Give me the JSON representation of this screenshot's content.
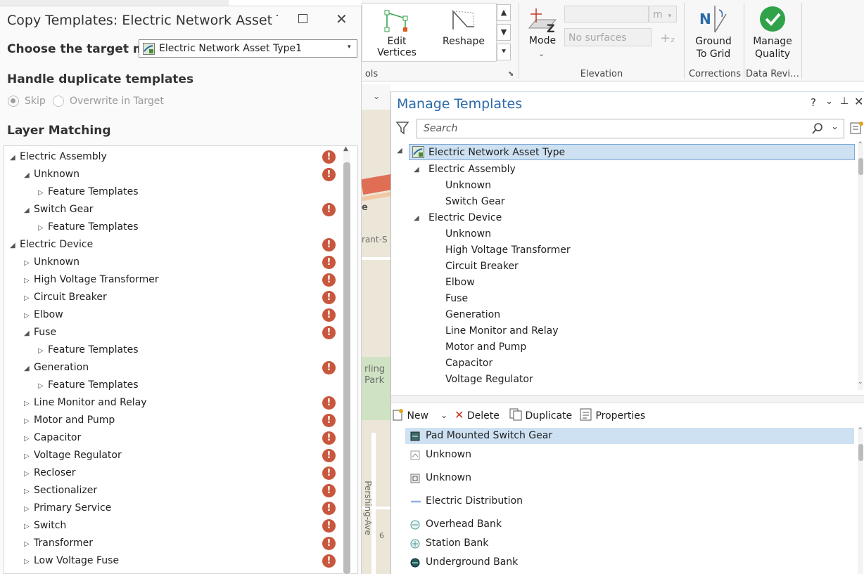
{
  "ribbon": {
    "edit_vertices_label": "Edit\nVertices",
    "reshape_label": "Reshape",
    "tools_group_label": "ols",
    "mode_label": "Mode",
    "unit_value": "m",
    "surface_placeholder": "No surfaces",
    "elevation_group_label": "Elevation",
    "ground_to_grid_label": "Ground\nTo Grid",
    "corrections_group_label": "Corrections",
    "manage_quality_label": "Manage\nQuality",
    "data_reviewer_group_label": "Data Revi…",
    "colors": {
      "green": "#2fa24a",
      "accent_blue": "#2b6aa8"
    }
  },
  "map": {
    "labels": [
      "e",
      "rant-S",
      "rling",
      "Park",
      "Pershing-Ave",
      "6"
    ]
  },
  "copy_dialog": {
    "title": "Copy Templates: Electric Network Asset Typ",
    "target_label": "Choose the target map",
    "target_value": "Electric Network Asset Type1",
    "duplicates_title": "Handle duplicate templates",
    "skip_label": "Skip",
    "overwrite_label": "Overwrite in Target",
    "layer_matching_title": "Layer Matching",
    "tree": [
      {
        "label": "Electric Assembly",
        "level": 0,
        "expanded": true,
        "warn": true
      },
      {
        "label": "Unknown",
        "level": 1,
        "expanded": true,
        "warn": true
      },
      {
        "label": "Feature Templates",
        "level": 2,
        "expanded": false,
        "warn": false
      },
      {
        "label": "Switch Gear",
        "level": 1,
        "expanded": true,
        "warn": true
      },
      {
        "label": "Feature Templates",
        "level": 2,
        "expanded": false,
        "warn": false
      },
      {
        "label": "Electric Device",
        "level": 0,
        "expanded": true,
        "warn": true
      },
      {
        "label": "Unknown",
        "level": 1,
        "expanded": false,
        "warn": true
      },
      {
        "label": "High Voltage Transformer",
        "level": 1,
        "expanded": false,
        "warn": true
      },
      {
        "label": "Circuit Breaker",
        "level": 1,
        "expanded": false,
        "warn": true
      },
      {
        "label": "Elbow",
        "level": 1,
        "expanded": false,
        "warn": true
      },
      {
        "label": "Fuse",
        "level": 1,
        "expanded": true,
        "warn": true
      },
      {
        "label": "Feature Templates",
        "level": 2,
        "expanded": false,
        "warn": false
      },
      {
        "label": "Generation",
        "level": 1,
        "expanded": true,
        "warn": true
      },
      {
        "label": "Feature Templates",
        "level": 2,
        "expanded": false,
        "warn": false
      },
      {
        "label": "Line Monitor and Relay",
        "level": 1,
        "expanded": false,
        "warn": true
      },
      {
        "label": "Motor and Pump",
        "level": 1,
        "expanded": false,
        "warn": true
      },
      {
        "label": "Capacitor",
        "level": 1,
        "expanded": false,
        "warn": true
      },
      {
        "label": "Voltage Regulator",
        "level": 1,
        "expanded": false,
        "warn": true
      },
      {
        "label": "Recloser",
        "level": 1,
        "expanded": false,
        "warn": true
      },
      {
        "label": "Sectionalizer",
        "level": 1,
        "expanded": false,
        "warn": true
      },
      {
        "label": "Primary Service",
        "level": 1,
        "expanded": false,
        "warn": true
      },
      {
        "label": "Switch",
        "level": 1,
        "expanded": false,
        "warn": true
      },
      {
        "label": "Transformer",
        "level": 1,
        "expanded": false,
        "warn": true
      },
      {
        "label": "Low Voltage Fuse",
        "level": 1,
        "expanded": false,
        "warn": true
      }
    ],
    "warn_glyph": "!",
    "colors": {
      "warning": "#c8573d"
    }
  },
  "manage_templates": {
    "title": "Manage Templates",
    "help_glyph": "?",
    "search_placeholder": "Search",
    "map_node": "Electric Network Asset Type",
    "layers": [
      {
        "label": "Electric Assembly",
        "kind": "group"
      },
      {
        "label": "Unknown",
        "kind": "item"
      },
      {
        "label": "Switch Gear",
        "kind": "item"
      },
      {
        "label": "Electric Device",
        "kind": "group"
      },
      {
        "label": "Unknown",
        "kind": "item"
      },
      {
        "label": "High Voltage Transformer",
        "kind": "item"
      },
      {
        "label": "Circuit Breaker",
        "kind": "item"
      },
      {
        "label": "Elbow",
        "kind": "item"
      },
      {
        "label": "Fuse",
        "kind": "item"
      },
      {
        "label": "Generation",
        "kind": "item"
      },
      {
        "label": "Line Monitor and Relay",
        "kind": "item"
      },
      {
        "label": "Motor and Pump",
        "kind": "item"
      },
      {
        "label": "Capacitor",
        "kind": "item"
      },
      {
        "label": "Voltage Regulator",
        "kind": "item"
      }
    ],
    "toolbar": {
      "new_label": "New",
      "delete_label": "Delete",
      "duplicate_label": "Duplicate",
      "properties_label": "Properties"
    },
    "templates": [
      {
        "label": "Pad Mounted Switch Gear",
        "icon": "switchgear-icon",
        "selected": true
      },
      {
        "label": "Unknown",
        "icon": "generic-point-icon",
        "selected": false
      },
      {
        "label": "Unknown",
        "icon": "generic-box-icon",
        "selected": false
      },
      {
        "label": "Electric Distribution",
        "icon": "line-icon",
        "selected": false
      },
      {
        "label": "Overhead Bank",
        "icon": "overhead-bank-icon",
        "selected": false
      },
      {
        "label": "Station Bank",
        "icon": "station-bank-icon",
        "selected": false
      },
      {
        "label": "Underground Bank",
        "icon": "underground-bank-icon",
        "selected": false
      }
    ]
  }
}
